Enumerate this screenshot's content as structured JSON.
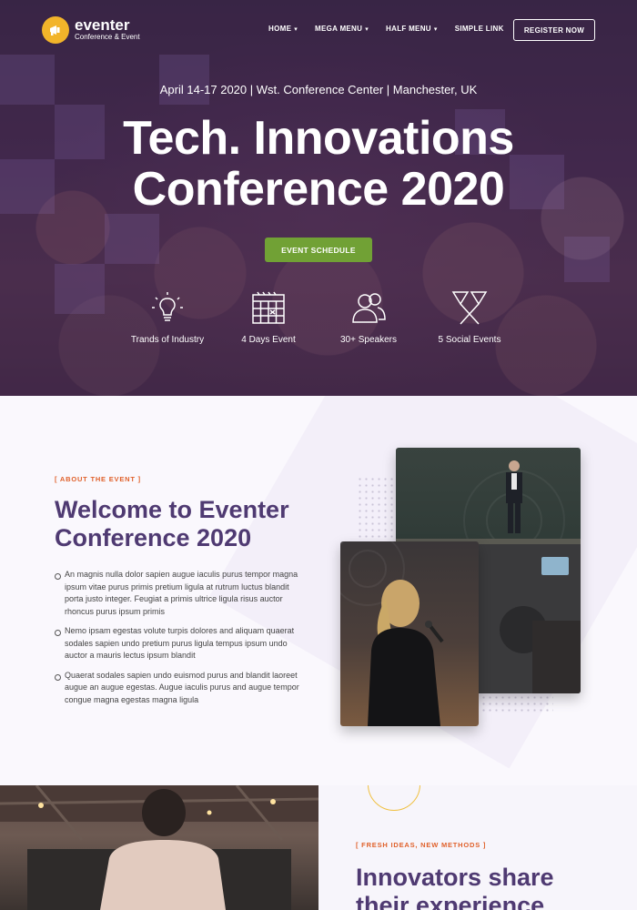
{
  "brand": {
    "name": "eventer",
    "tagline": "Conference & Event"
  },
  "nav": {
    "items": [
      {
        "label": "HOME",
        "has_dropdown": true
      },
      {
        "label": "MEGA MENU",
        "has_dropdown": true
      },
      {
        "label": "HALF MENU",
        "has_dropdown": true
      },
      {
        "label": "SIMPLE LINK",
        "has_dropdown": false
      }
    ],
    "register_label": "REGISTER NOW"
  },
  "hero": {
    "date_line": "April 14-17 2020 | Wst. Conference Center | Manchester, UK",
    "title_line1": "Tech. Innovations",
    "title_line2": "Conference 2020",
    "cta_label": "EVENT SCHEDULE",
    "features": [
      {
        "icon": "lightbulb-icon",
        "label": "Trands of Industry"
      },
      {
        "icon": "calendar-icon",
        "label": "4 Days Event"
      },
      {
        "icon": "speakers-icon",
        "label": "30+ Speakers"
      },
      {
        "icon": "cocktail-icon",
        "label": "5 Social Events"
      }
    ]
  },
  "about": {
    "eyebrow": "[ ABOUT THE EVENT ]",
    "title_line1": "Welcome to Eventer",
    "title_line2": "Conference 2020",
    "bullets": [
      "An magnis nulla dolor sapien augue iaculis purus tempor magna ipsum vitae purus primis pretium ligula at rutrum luctus blandit porta justo integer. Feugiat a primis ultrice ligula risus auctor rhoncus purus ipsum primis",
      "Nemo ipsam egestas volute turpis dolores and aliquam quaerat sodales sapien undo pretium purus ligula tempus ipsum undo auctor a mauris lectus ipsum blandit",
      "Quaerat sodales sapien undo euismod purus and blandit laoreet augue an augue egestas. Augue iaculis purus and augue tempor congue magna egestas magna ligula"
    ]
  },
  "innovators": {
    "eyebrow": "[ FRESH IDEAS, NEW METHODS ]",
    "title_line1": "Innovators share",
    "title_line2": "their experience"
  },
  "colors": {
    "accent_green": "#71a135",
    "heading_purple": "#4f3a72",
    "eyebrow_orange": "#e0612b",
    "logo_yellow": "#f2b42a"
  }
}
